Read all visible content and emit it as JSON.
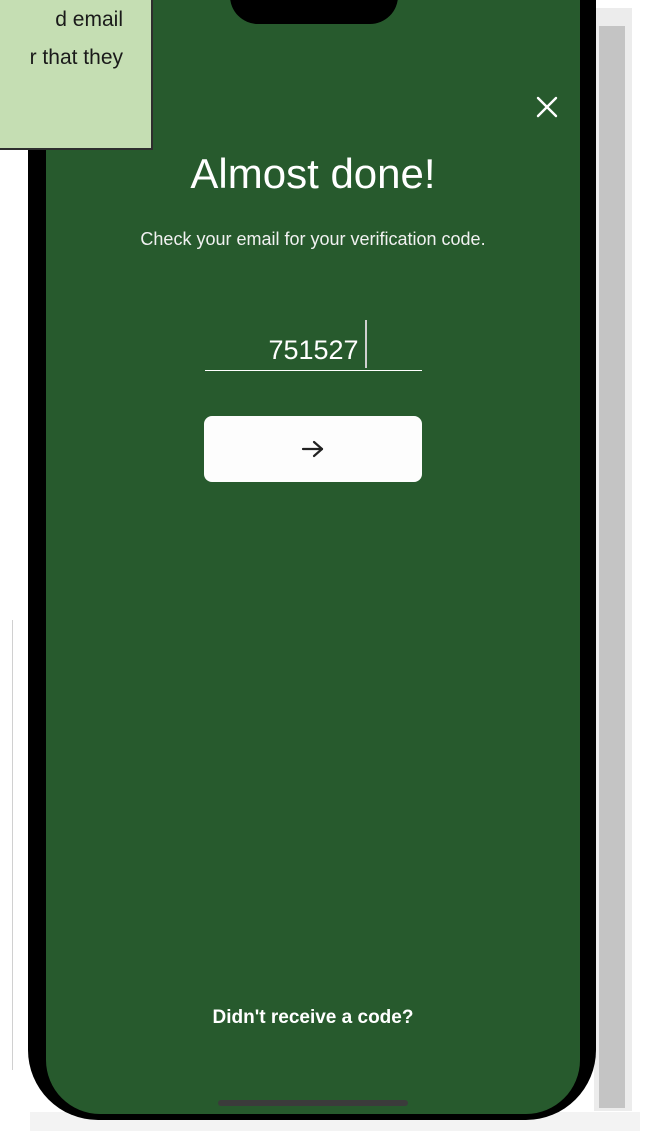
{
  "annotation": {
    "line1": "d email",
    "line2": "r that they"
  },
  "screen": {
    "title": "Almost done!",
    "subtitle": "Check your email for your verification code.",
    "code_value": "751527",
    "submit_icon": "arrow-right-icon",
    "close_icon": "close-icon",
    "resend_link": "Didn't receive a code?"
  },
  "colors": {
    "screen_background": "#275a2d",
    "button_background": "#fdfdfd",
    "callout_background": "#c5deb3",
    "text": "#ffffff"
  }
}
